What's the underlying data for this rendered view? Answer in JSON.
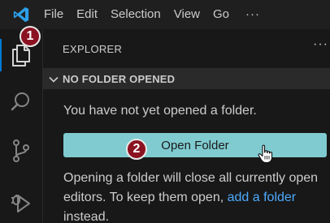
{
  "app": {
    "logo_icon": "vscode-logo-icon",
    "accent": "#0078d4"
  },
  "menu": {
    "items": [
      "File",
      "Edit",
      "Selection",
      "View",
      "Go"
    ],
    "more": "···"
  },
  "activity_bar": {
    "items": [
      {
        "name": "explorer",
        "icon": "files-icon",
        "active": true
      },
      {
        "name": "search",
        "icon": "search-icon",
        "active": false
      },
      {
        "name": "source-control",
        "icon": "source-control-icon",
        "active": false
      },
      {
        "name": "run-debug",
        "icon": "debug-icon",
        "active": false
      }
    ]
  },
  "sidebar": {
    "title": "EXPLORER",
    "more": "···",
    "section_title": "NO FOLDER OPENED",
    "message": "You have not yet opened a folder.",
    "open_button_label": "Open Folder",
    "open_button_color": "#7fcbd0",
    "help_before": "Opening a folder will close all currently open editors. To keep them open, ",
    "help_link": "add a folder",
    "help_after": " instead."
  },
  "annotations": {
    "step1": "1",
    "step2": "2",
    "badge_color": "#8b1220"
  }
}
